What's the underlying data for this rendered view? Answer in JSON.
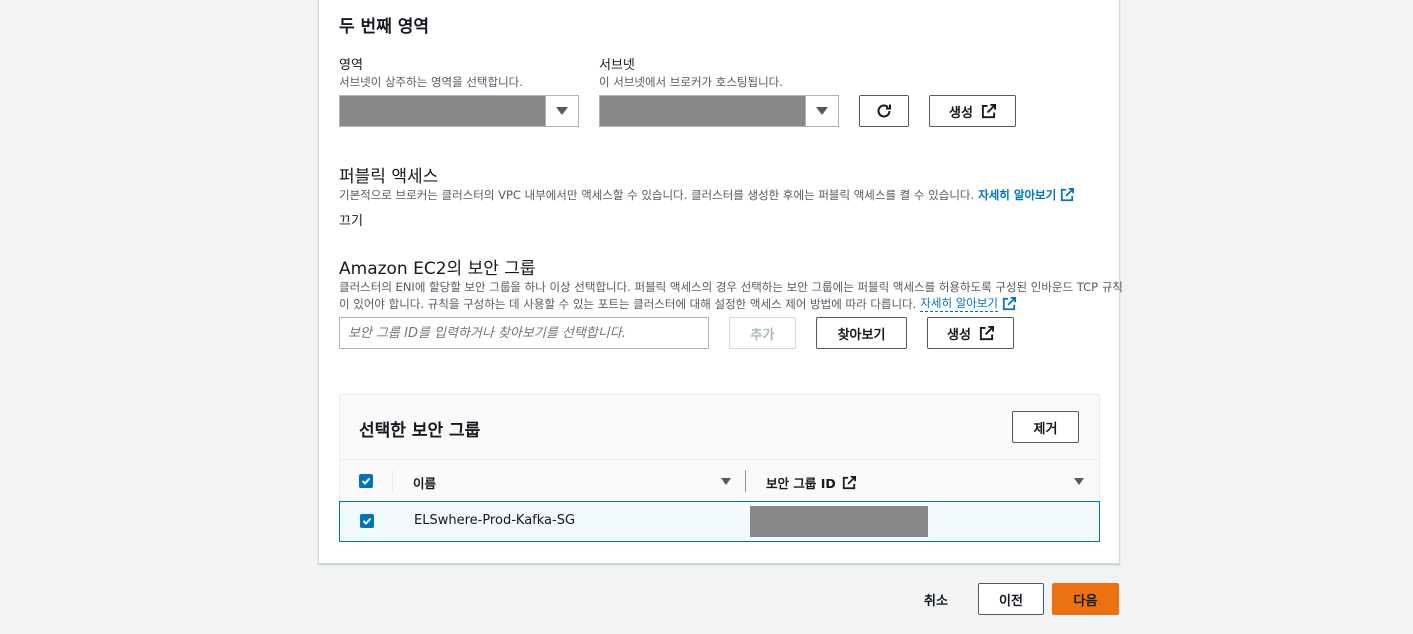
{
  "second_region": {
    "heading": "두 번째 영역",
    "region_label": "영역",
    "region_desc": "서브넷이 상주하는 영역을 선택합니다.",
    "subnet_label": "서브넷",
    "subnet_desc": "이 서브넷에서 브로커가 호스팅됩니다.",
    "create_label": "생성"
  },
  "public_access": {
    "heading": "퍼블릭 액세스",
    "desc": "기본적으로 브로커는 클러스터의 VPC 내부에서만 액세스할 수 있습니다. 클러스터를 생성한 후에는 퍼블릭 액세스를 켤 수 있습니다.",
    "learn_more": "자세히 알아보기",
    "value": "끄기"
  },
  "security_groups": {
    "heading": "Amazon EC2의 보안 그룹",
    "desc_line1": "클러스터의 ENI에 할당할 보안 그룹을 하나 이상 선택합니다. 퍼블릭 액세스의 경우 선택하는 보안 그룹에는 퍼블릭 액세스를 허용하도록 구성된 인바운드 TCP 규칙",
    "desc_line2": "이 있어야 합니다. 규칙을 구성하는 데 사용할 수 있는 포트는 클러스터에 대해 설정한 액세스 제어 방법에 따라 다릅니다.",
    "learn_more": "자세히 알아보기",
    "input_placeholder": "보안 그룹 ID를 입력하거나 찾아보기를 선택합니다.",
    "add_label": "추가",
    "browse_label": "찾아보기",
    "create_label": "생성"
  },
  "selected_table": {
    "heading": "선택한 보안 그룹",
    "remove_label": "제거",
    "columns": {
      "name": "이름",
      "group_id": "보안 그룹 ID"
    },
    "rows": [
      {
        "name": "ELSwhere-Prod-Kafka-SG",
        "checked": true
      }
    ]
  },
  "footer": {
    "cancel": "취소",
    "previous": "이전",
    "next": "다음"
  },
  "colors": {
    "accent": "#0073bb",
    "primary_button": "#ec7211",
    "redacted": "#888888"
  }
}
